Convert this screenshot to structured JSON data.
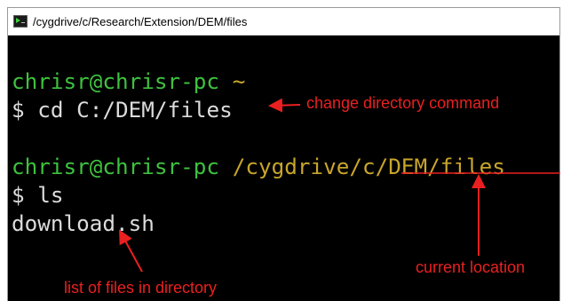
{
  "window": {
    "title": "/cygdrive/c/Research/Extension/DEM/files"
  },
  "terminal": {
    "line1": {
      "user_host": "chrisr@chrisr-pc",
      "path": "~"
    },
    "line2": {
      "prompt": "$",
      "command": "cd C:/DEM/files"
    },
    "line4": {
      "user_host": "chrisr@chrisr-pc",
      "path": "/cygdrive/c/DEM/files"
    },
    "line5": {
      "prompt": "$",
      "command": "ls"
    },
    "line6": {
      "output": "download.sh"
    }
  },
  "annotations": {
    "cd_note": "change directory command",
    "location_note": "current location",
    "ls_note": "list of files in directory"
  },
  "colors": {
    "prompt_green": "#3ec23e",
    "path_gold": "#c8a62b",
    "text_white": "#dcdcdc",
    "annotation_red": "#ea2020"
  }
}
